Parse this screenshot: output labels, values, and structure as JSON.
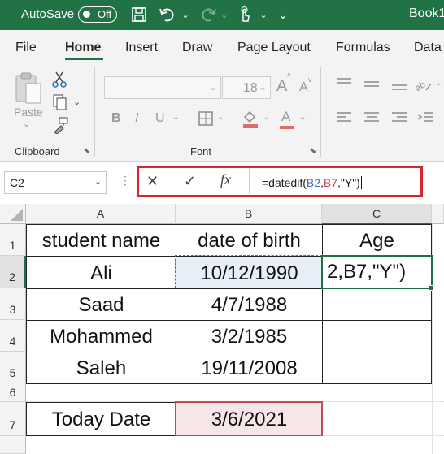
{
  "titlebar": {
    "autosave_label": "AutoSave",
    "autosave_state": "Off",
    "book_title": "Book1"
  },
  "tabs": [
    "File",
    "Home",
    "Insert",
    "Draw",
    "Page Layout",
    "Formulas",
    "Data"
  ],
  "ribbon": {
    "paste_label": "Paste",
    "clipboard_label": "Clipboard",
    "font_label": "Font",
    "font_size": "18",
    "font_grow": "A",
    "font_shrink": "A",
    "bold": "B",
    "italic": "I",
    "underline": "U",
    "font_color_letter": "A"
  },
  "formula_bar": {
    "name_box": "C2",
    "cancel": "✕",
    "enter": "✓",
    "fx": "fx",
    "formula_prefix": "=datedif(",
    "ref1": "B2",
    "comma1": ",",
    "ref2": "B7",
    "formula_suffix": ",\"Y\")"
  },
  "grid": {
    "columns": [
      "A",
      "B",
      "C"
    ],
    "rows": [
      "1",
      "2",
      "3",
      "4",
      "5",
      "6",
      "7"
    ],
    "headers": {
      "a": "student name",
      "b": "date of birth",
      "c": "Age"
    },
    "students": [
      {
        "name": "Ali",
        "dob": "10/12/1990"
      },
      {
        "name": "Saad",
        "dob": "4/7/1988"
      },
      {
        "name": "Mohammed",
        "dob": "3/2/1985"
      },
      {
        "name": "Saleh",
        "dob": "19/11/2008"
      }
    ],
    "c2_display": "2,B7,\"Y\")",
    "today_label": "Today Date",
    "today_value": "3/6/2021"
  },
  "colors": {
    "excel_green": "#217346",
    "highlight_red": "#d9232d",
    "selected_green": "#1e7145",
    "b2_fill": "#e7eef8",
    "b7_fill": "#f7e6e8"
  }
}
